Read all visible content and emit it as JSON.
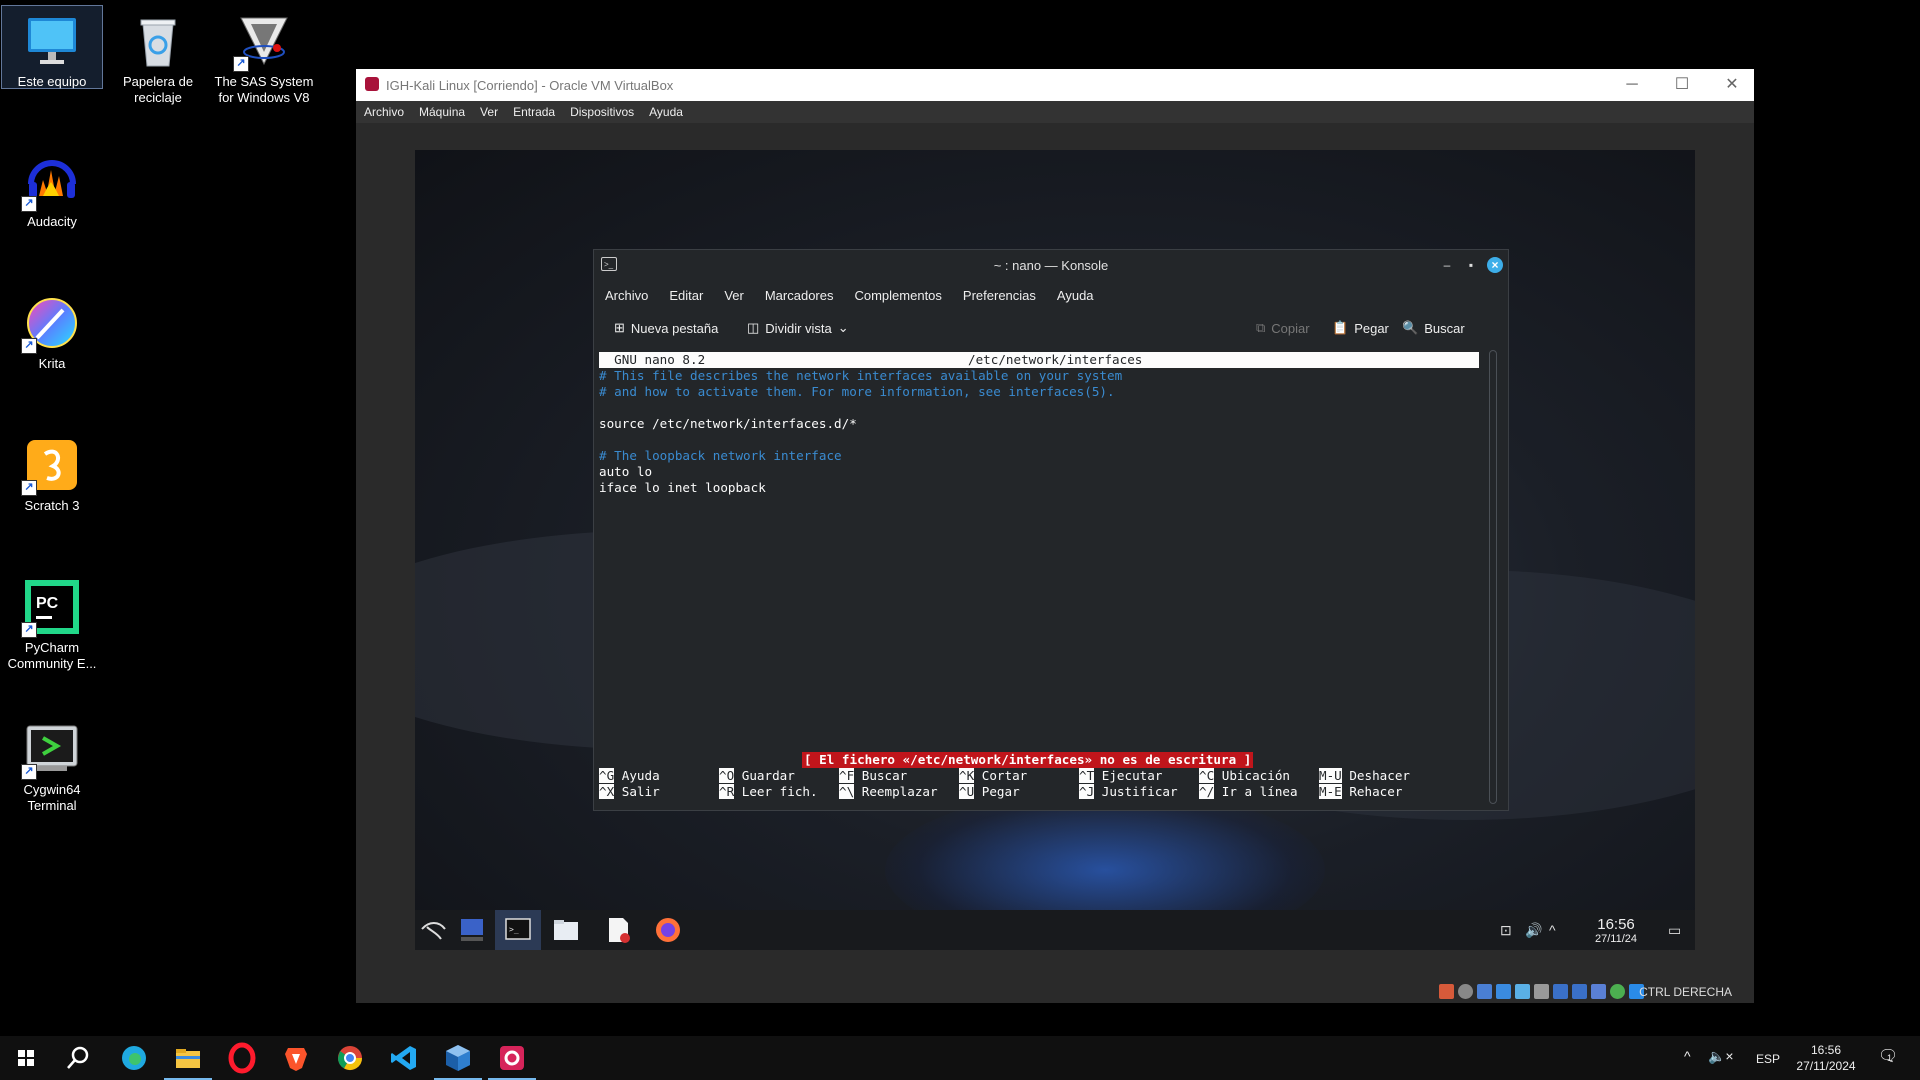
{
  "desktop": {
    "icons": [
      {
        "label": "Este equipo",
        "icon": "monitor-icon"
      },
      {
        "label": "Papelera de reciclaje",
        "icon": "recycle-bin-icon"
      },
      {
        "label": "The SAS System for Windows V8",
        "icon": "sas-icon"
      },
      {
        "label": "Audacity",
        "icon": "audacity-icon"
      },
      {
        "label": "Krita",
        "icon": "krita-icon"
      },
      {
        "label": "Scratch 3",
        "icon": "scratch-icon"
      },
      {
        "label": "PyCharm Community E...",
        "icon": "pycharm-icon"
      },
      {
        "label": "Cygwin64 Terminal",
        "icon": "cygwin-icon"
      }
    ]
  },
  "vbox": {
    "title": "IGH-Kali Linux [Corriendo] - Oracle VM VirtualBox",
    "menu": [
      "Archivo",
      "Máquina",
      "Ver",
      "Entrada",
      "Dispositivos",
      "Ayuda"
    ],
    "status_right": "CTRL DERECHA"
  },
  "konsole": {
    "title": "~ : nano — Konsole",
    "menu": [
      "Archivo",
      "Editar",
      "Ver",
      "Marcadores",
      "Complementos",
      "Preferencias",
      "Ayuda"
    ],
    "toolbar": {
      "new_tab": "Nueva pestaña",
      "split_view": "Dividir vista",
      "copy": "Copiar",
      "paste": "Pegar",
      "search": "Buscar"
    }
  },
  "nano": {
    "version": "GNU nano 8.2",
    "file": "/etc/network/interfaces",
    "lines": [
      {
        "text": "# This file describes the network interfaces available on your system",
        "comment": true
      },
      {
        "text": "# and how to activate them. For more information, see interfaces(5).",
        "comment": true
      },
      {
        "text": "",
        "comment": false
      },
      {
        "text": "source /etc/network/interfaces.d/*",
        "comment": false
      },
      {
        "text": "",
        "comment": false
      },
      {
        "text": "# The loopback network interface",
        "comment": true
      },
      {
        "text": "auto lo",
        "comment": false
      },
      {
        "text": "iface lo inet loopback",
        "comment": false
      }
    ],
    "message": "[ El fichero «/etc/network/interfaces» no es de escritura ]",
    "shortcuts": [
      {
        "key": "^G",
        "label": "Ayuda"
      },
      {
        "key": "^O",
        "label": "Guardar"
      },
      {
        "key": "^F",
        "label": "Buscar"
      },
      {
        "key": "^K",
        "label": "Cortar"
      },
      {
        "key": "^T",
        "label": "Ejecutar"
      },
      {
        "key": "^C",
        "label": "Ubicación"
      },
      {
        "key": "M-U",
        "label": "Deshacer"
      },
      {
        "key": "^X",
        "label": "Salir"
      },
      {
        "key": "^R",
        "label": "Leer fich."
      },
      {
        "key": "^\\",
        "label": "Reemplazar"
      },
      {
        "key": "^U",
        "label": "Pegar"
      },
      {
        "key": "^J",
        "label": "Justificar"
      },
      {
        "key": "^/",
        "label": "Ir a línea"
      },
      {
        "key": "M-E",
        "label": "Rehacer"
      }
    ]
  },
  "kali_panel": {
    "time": "16:56",
    "date": "27/11/24"
  },
  "taskbar": {
    "lang": "ESP",
    "time": "16:56",
    "date": "27/11/2024",
    "notifications": "1"
  }
}
